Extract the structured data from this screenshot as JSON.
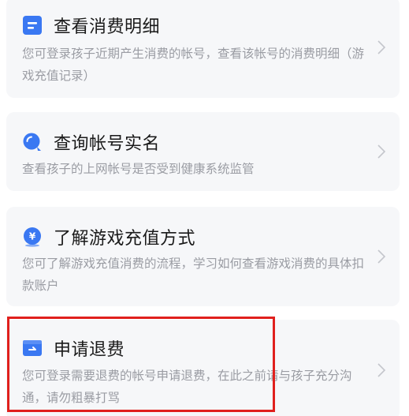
{
  "cards": [
    {
      "title": "查看消费明细",
      "description": "您可登录孩子近期产生消费的帐号，查看该帐号的消费明细（游戏充值记录）",
      "icon": "document-icon"
    },
    {
      "title": "查询帐号实名",
      "description": "查看孩子的上网帐号是否受到健康系统监管",
      "icon": "search-icon"
    },
    {
      "title": "了解游戏充值方式",
      "description": "您可了解游戏充值消费的流程，学习如何查看游戏消费的具体扣款账户",
      "icon": "yuan-coin-icon"
    },
    {
      "title": "申请退费",
      "description": "您可登录需要退费的帐号申请退费，在此之前请与孩子充分沟通，请勿粗暴打骂",
      "icon": "refund-card-icon"
    }
  ],
  "colors": {
    "accent": "#3a78f2",
    "highlight": "#e0201d",
    "card_bg": "#f6f7f9",
    "title_text": "#1a1a1a",
    "desc_text": "#9a9ca3"
  }
}
